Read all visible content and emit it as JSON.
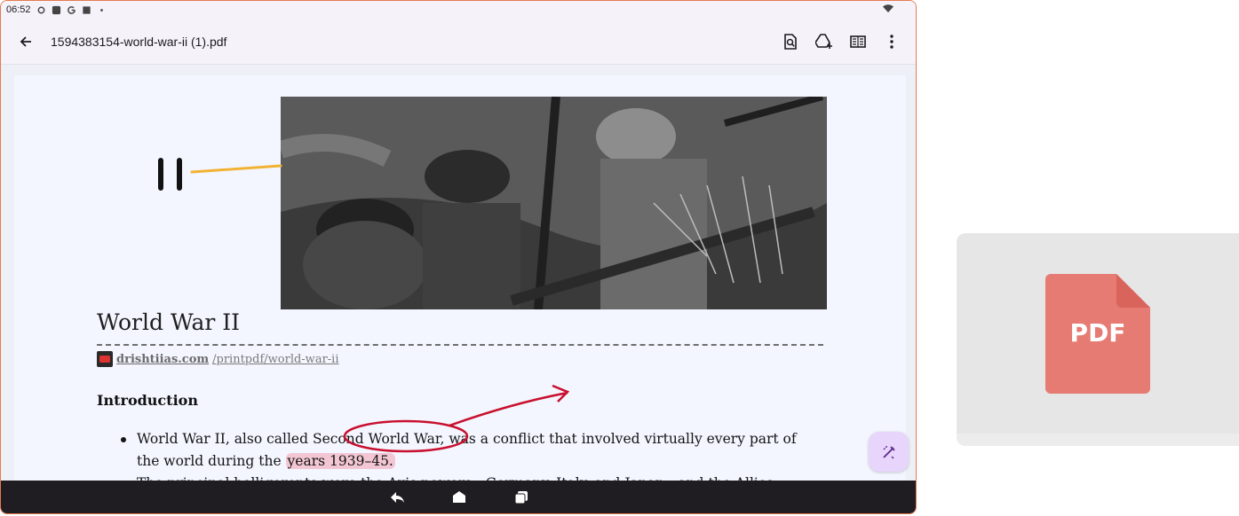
{
  "status_bar": {
    "time": "06:52"
  },
  "app_bar": {
    "file_name": "1594383154-world-war-ii (1).pdf",
    "icons": [
      "back-arrow-icon",
      "find-in-page-icon",
      "drive-add-icon",
      "reader-mode-icon",
      "more-vert-icon"
    ]
  },
  "document": {
    "handwritten_mark": "II",
    "title": "World War II",
    "source_domain": "drishtiias.com",
    "source_path": "/printpdf/world-war-ii",
    "section_heading": "Introduction",
    "bullet1_a": "World War II, also called Second World War, was a conflict that involved virtually every part of the world during the ",
    "bullet1_highlight": "years 1939–45.",
    "bullet2": "The principal belligerents were the Axis powers—Germany, Italy, and Japan—and the Allies"
  },
  "annotation_colors": {
    "ink_red": "#c8102e",
    "highlight_pink": "#f2c6d3",
    "pen_yellow": "#f2b233"
  },
  "preview": {
    "label": "PDF",
    "color": "#e57b72"
  },
  "nav_bar": {
    "icons": [
      "back-icon",
      "home-icon",
      "recents-icon"
    ]
  }
}
